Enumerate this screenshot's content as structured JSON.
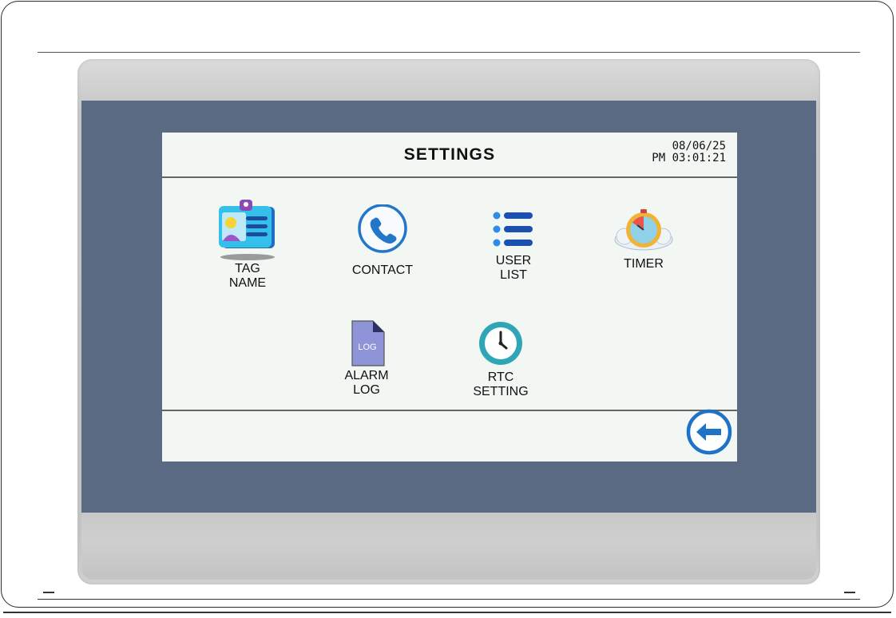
{
  "header": {
    "title": "SETTINGS",
    "date": "08/06/25",
    "time": "PM 03:01:21"
  },
  "menu": {
    "items": [
      {
        "label_line1": "TAG",
        "label_line2": "NAME",
        "icon": "id-card-icon"
      },
      {
        "label_line1": "CONTACT",
        "label_line2": "",
        "icon": "phone-icon"
      },
      {
        "label_line1": "USER",
        "label_line2": "LIST",
        "icon": "list-icon"
      },
      {
        "label_line1": "TIMER",
        "label_line2": "",
        "icon": "timer-icon"
      },
      {
        "label_line1": "ALARM",
        "label_line2": "LOG",
        "icon": "log-file-icon"
      },
      {
        "label_line1": "RTC",
        "label_line2": "SETTING",
        "icon": "clock-icon"
      }
    ]
  },
  "log_icon_text": "LOG",
  "footer": {
    "back_icon": "back-arrow-icon"
  },
  "colors": {
    "accent_blue": "#1f73c7",
    "screen_bg": "#f2f7f4",
    "bezel_band": "#596a82"
  }
}
